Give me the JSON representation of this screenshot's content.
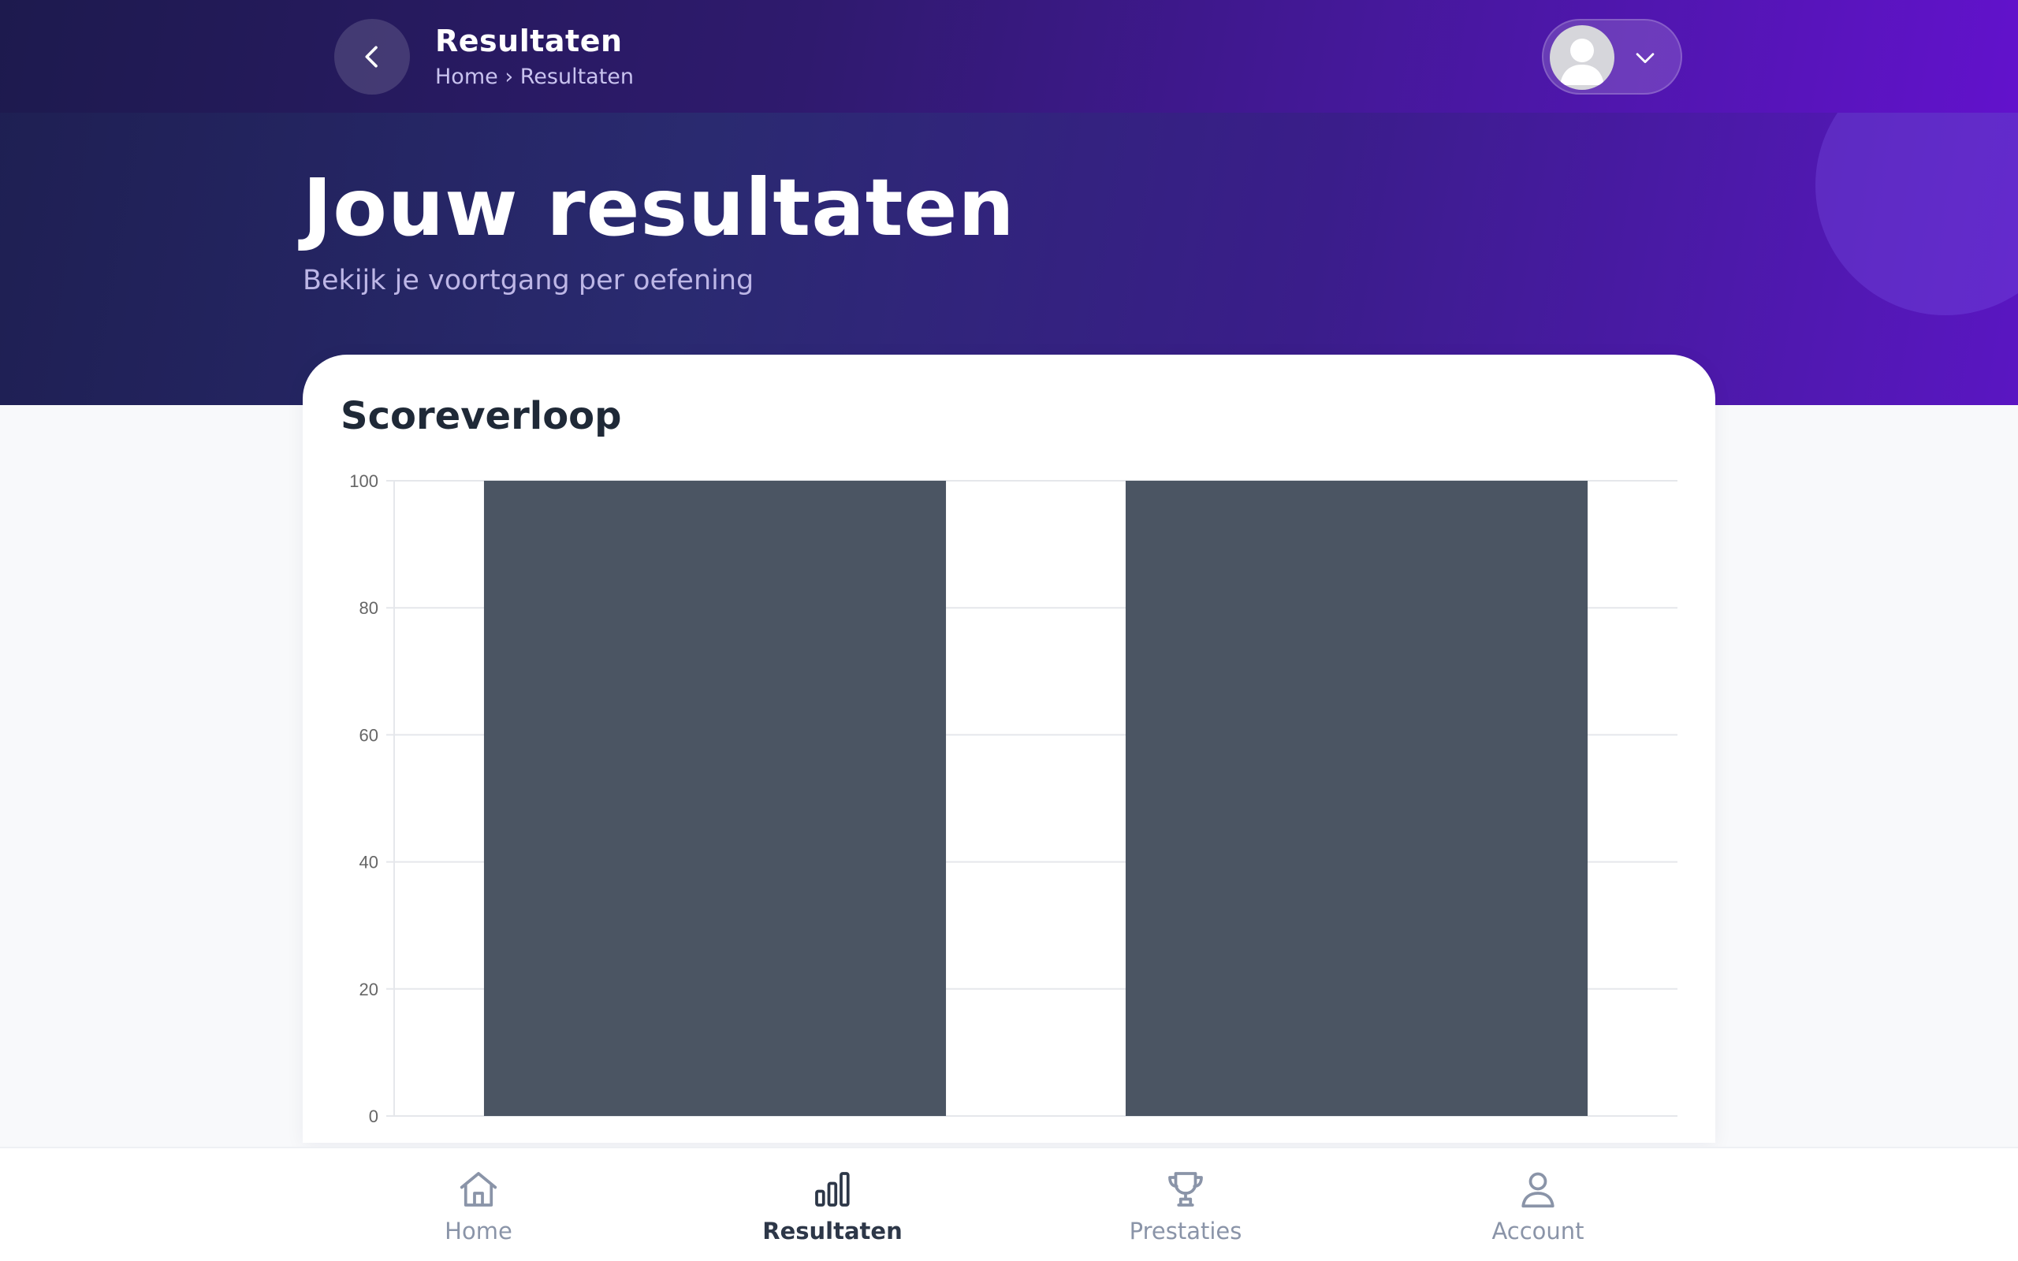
{
  "header": {
    "title": "Resultaten",
    "breadcrumb": [
      "Home",
      "Resultaten"
    ],
    "breadcrumb_separator": "›"
  },
  "hero": {
    "title": "Jouw resultaten",
    "subtitle": "Bekijk je voortgang per oefening"
  },
  "card": {
    "title": "Scoreverloop"
  },
  "chart_data": {
    "type": "bar",
    "categories": [
      "",
      ""
    ],
    "values": [
      100,
      100
    ],
    "ylim": [
      0,
      100
    ],
    "yticks": [
      0,
      20,
      40,
      60,
      80,
      100
    ],
    "bar_color": "#4b5563",
    "grid": true
  },
  "nav": {
    "items": [
      {
        "label": "Home",
        "icon": "home-icon",
        "active": false
      },
      {
        "label": "Resultaten",
        "icon": "bar-chart-icon",
        "active": true
      },
      {
        "label": "Prestaties",
        "icon": "trophy-icon",
        "active": false
      },
      {
        "label": "Account",
        "icon": "user-icon",
        "active": false
      }
    ]
  },
  "colors": {
    "accent": "#5a16c2",
    "hero_dark": "#1e1f52",
    "bar": "#4b5563",
    "nav_active": "#2d3748",
    "nav_inactive": "#8a94a8"
  }
}
